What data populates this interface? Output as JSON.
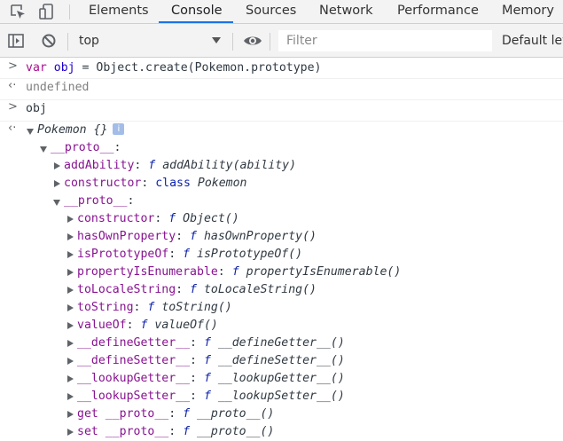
{
  "tabs": [
    {
      "label": "Elements"
    },
    {
      "label": "Console"
    },
    {
      "label": "Sources"
    },
    {
      "label": "Network"
    },
    {
      "label": "Performance"
    },
    {
      "label": "Memory"
    }
  ],
  "active_tab": "Console",
  "toolbar": {
    "context": "top",
    "filter_placeholder": "Filter",
    "filter_value": "",
    "levels_label": "Default levels"
  },
  "console": {
    "input1": {
      "kw": "var",
      "name": "obj",
      "rest": " = Object.create(Pokemon.prototype)"
    },
    "output1": "undefined",
    "input2": "obj",
    "object_label": "Pokemon {}",
    "info_badge": "i",
    "proto_label": "__proto__",
    "level1": [
      {
        "key": "addAbility",
        "value": "addAbility(ability)",
        "kind": "f"
      },
      {
        "key": "constructor",
        "value": "Pokemon",
        "kind": "class"
      }
    ],
    "level2": [
      {
        "key": "constructor",
        "value": "Object()"
      },
      {
        "key": "hasOwnProperty",
        "value": "hasOwnProperty()"
      },
      {
        "key": "isPrototypeOf",
        "value": "isPrototypeOf()"
      },
      {
        "key": "propertyIsEnumerable",
        "value": "propertyIsEnumerable()"
      },
      {
        "key": "toLocaleString",
        "value": "toLocaleString()"
      },
      {
        "key": "toString",
        "value": "toString()"
      },
      {
        "key": "valueOf",
        "value": "valueOf()"
      },
      {
        "key": "__defineGetter__",
        "value": "__defineGetter__()"
      },
      {
        "key": "__defineSetter__",
        "value": "__defineSetter__()"
      },
      {
        "key": "__lookupGetter__",
        "value": "__lookupGetter__()"
      },
      {
        "key": "__lookupSetter__",
        "value": "__lookupSetter__()"
      },
      {
        "key": "get __proto__",
        "value": "__proto__()"
      },
      {
        "key": "set __proto__",
        "value": "__proto__()"
      }
    ],
    "f_glyph": "f",
    "class_kw": "class"
  },
  "colors": {
    "accent": "#1a73e8",
    "keyword": "#aa0d91",
    "property": "#881391",
    "function_marker": "#0d22aa"
  },
  "icons": [
    "inspect-element-icon",
    "device-toolbar-icon",
    "sidebar-toggle-icon",
    "clear-console-icon",
    "eye-icon"
  ]
}
